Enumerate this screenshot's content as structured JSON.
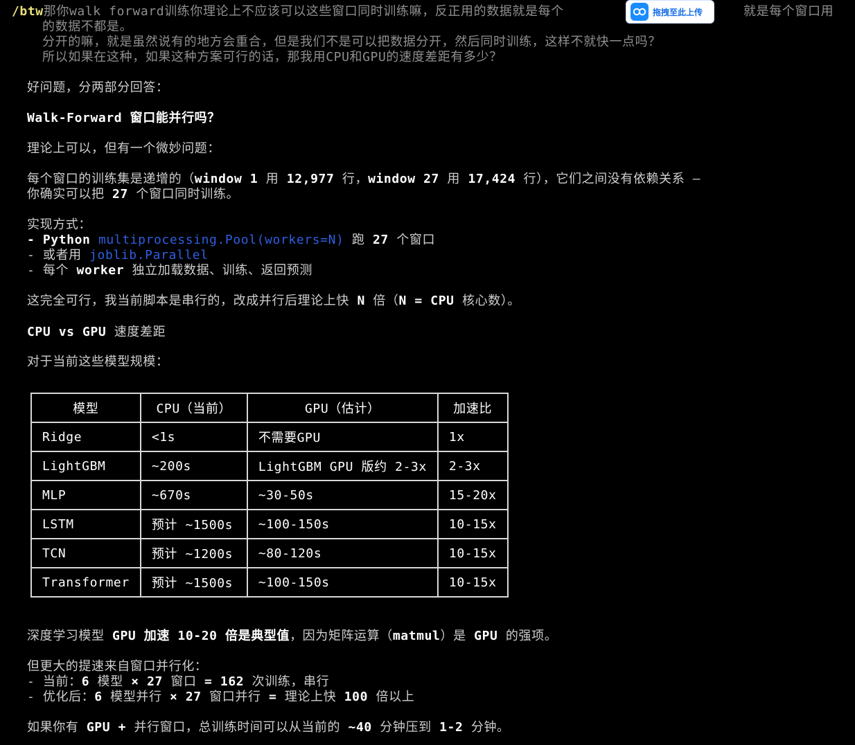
{
  "prompt": {
    "command": "/btw",
    "line1": "那你walk forward训练你理论上不应该可以这些窗口同时训练嘛，反正用的数据就是每个",
    "line1_tail": "就是每个窗口用",
    "line2": "的数据不都是。",
    "line3": "分开的嘛，就是虽然说有的地方会重合，但是我们不是可以把数据分开，然后同时训练，这样不就快一点吗？",
    "line4": "所以如果在这种，如果这种方案可行的话，那我用CPU和GPU的速度差距有多少？"
  },
  "upload_badge": {
    "label": "拖拽至此上传",
    "icon": "baidu-netdisk-icon"
  },
  "answer": {
    "intro": "好问题，分两部分回答：",
    "section1_title": "Walk-Forward 窗口能并行吗？",
    "s1_p1": "理论上可以，但有一个微妙问题：",
    "s1_p2a": "每个窗口的训练集是递增的（",
    "s1_p2b": "window 1",
    "s1_p2c": " 用 ",
    "s1_p2d": "12,977",
    "s1_p2e": " 行，",
    "s1_p2f": "window 27",
    "s1_p2g": " 用 ",
    "s1_p2h": "17,424",
    "s1_p2i": " 行），它们之间没有依赖关系 —",
    "s1_p3a": "你确实可以把 ",
    "s1_p3b": "27",
    "s1_p3c": " 个窗口同时训练。",
    "impl_title": "实现方式：",
    "impl1a": "- Python ",
    "impl1b": "multiprocessing.Pool(workers=N)",
    "impl1c": " 跑 ",
    "impl1d": "27",
    "impl1e": " 个窗口",
    "impl2a": "- 或者用 ",
    "impl2b": "joblib.Parallel",
    "impl3a": "- 每个 ",
    "impl3b": "worker",
    "impl3c": " 独立加载数据、训练、返回预测",
    "s1_concl_a": "这完全可行，我当前脚本是串行的，改成并行后理论上快 ",
    "s1_concl_b": "N",
    "s1_concl_c": " 倍（",
    "s1_concl_d": "N = CPU",
    "s1_concl_e": " 核心数）。",
    "section2_title_a": "CPU vs GPU",
    "section2_title_b": " 速度差距",
    "s2_intro": "对于当前这些模型规模：",
    "table": {
      "headers": [
        "模型",
        "CPU（当前）",
        "GPU（估计）",
        "加速比"
      ],
      "rows": [
        [
          "Ridge",
          "<1s",
          "不需要GPU",
          "1x"
        ],
        [
          "LightGBM",
          "~200s",
          "LightGBM GPU 版约 2-3x",
          "2-3x"
        ],
        [
          "MLP",
          "~670s",
          "~30-50s",
          "15-20x"
        ],
        [
          "LSTM",
          "预计 ~1500s",
          "~100-150s",
          "10-15x"
        ],
        [
          "TCN",
          "预计 ~1200s",
          "~80-120s",
          "10-15x"
        ],
        [
          "Transformer",
          "预计 ~1500s",
          "~100-150s",
          "10-15x"
        ]
      ]
    },
    "s2_p1a": "深度学习模型 ",
    "s2_p1b": "GPU 加速 10-20 倍是典型值",
    "s2_p1c": "，因为矩阵运算（",
    "s2_p1d": "matmul",
    "s2_p1e": "）是 ",
    "s2_p1f": "GPU",
    "s2_p1g": " 的强项。",
    "s2_p2": "但更大的提速来自窗口并行化：",
    "cur_a": "- 当前：",
    "cur_b": "6",
    "cur_c": " 模型 ",
    "cur_d": "× 27",
    "cur_e": " 窗口 ",
    "cur_f": "= 162",
    "cur_g": " 次训练，串行",
    "opt_a": "- 优化后：",
    "opt_b": "6",
    "opt_c": " 模型并行 ",
    "opt_d": "× 27",
    "opt_e": " 窗口并行 ",
    "opt_f": "=",
    "opt_g": " 理论上快 ",
    "opt_h": "100",
    "opt_i": " 倍以上",
    "final_a": "如果你有 ",
    "final_b": "GPU + ",
    "final_c": "并行窗口",
    "final_d": "，总训练时间可以从当前的 ",
    "final_e": "~40",
    "final_f": " 分钟压到 ",
    "final_g": "1-2",
    "final_h": " 分钟。"
  },
  "colors": {
    "background": "#000000",
    "text": "#cfcfcf",
    "bold_text": "#ffffff",
    "code_link": "#2f5fe0",
    "prompt_tag": "#e8e07a",
    "prompt_text": "#8f8f8f"
  }
}
